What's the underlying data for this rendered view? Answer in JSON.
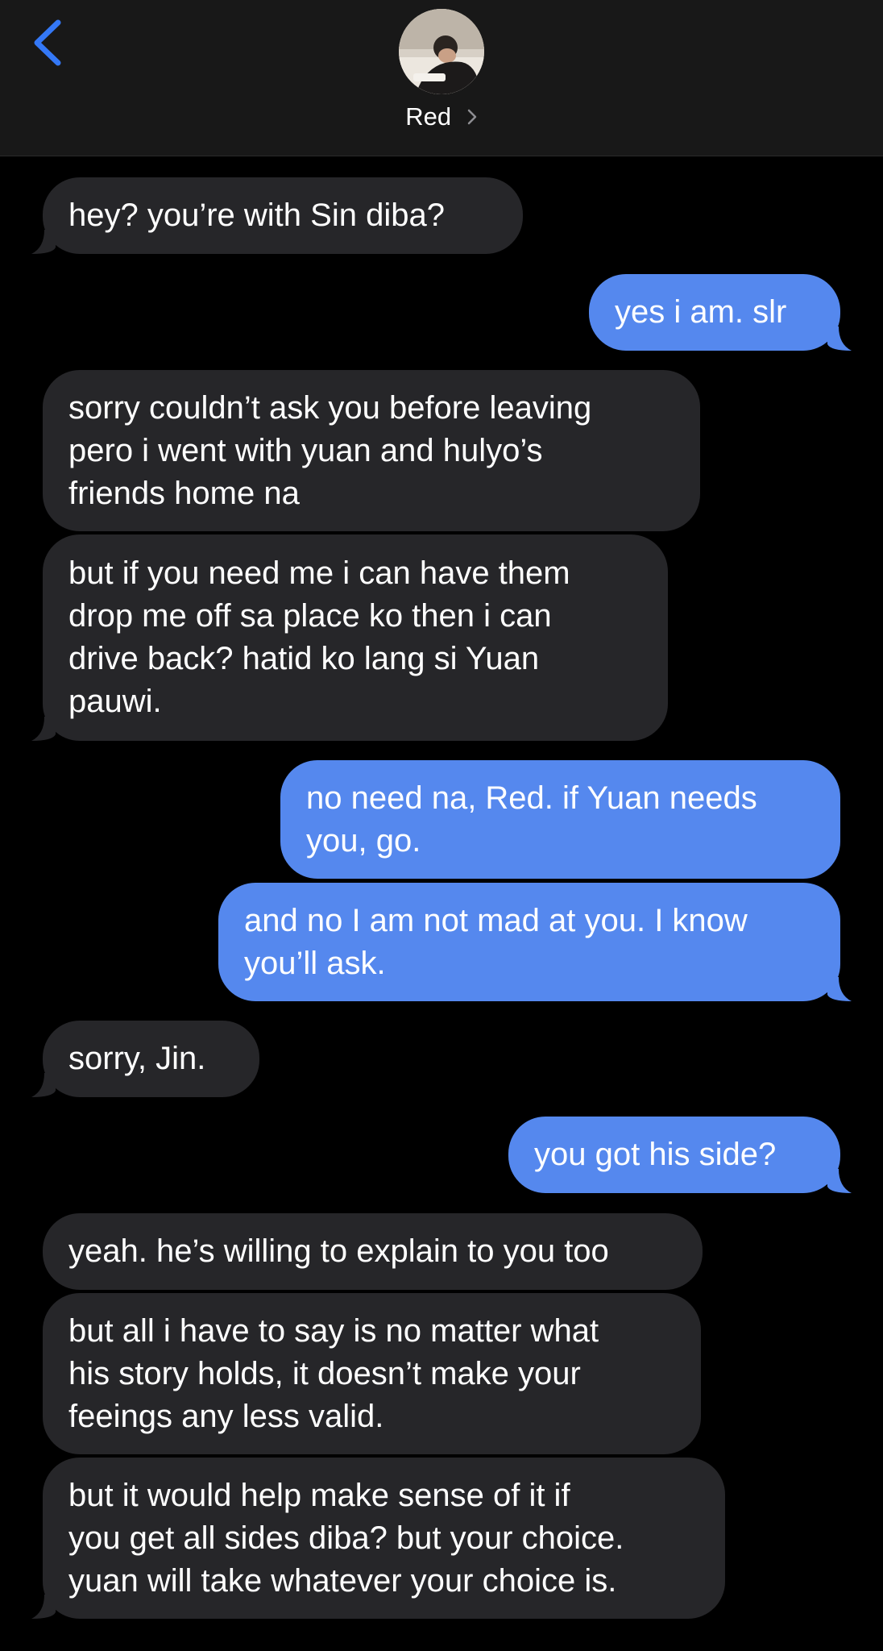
{
  "header": {
    "contact_name": "Red",
    "back_icon": "chevron-left-icon",
    "detail_icon": "chevron-right-icon"
  },
  "colors": {
    "incoming_bubble": "#262629",
    "outgoing_bubble": "#5588ee",
    "accent": "#3478f6",
    "background": "#000000"
  },
  "messages": [
    {
      "from": "them",
      "text": "hey? you’re with Sin diba?"
    },
    {
      "from": "me",
      "text": "yes i am. slr"
    },
    {
      "from": "them",
      "text": "sorry couldn’t ask you before leaving\npero i went with yuan and hulyo’s\nfriends home na"
    },
    {
      "from": "them",
      "text": "but if you need me i can have them\ndrop me off sa place ko then i can\ndrive back? hatid ko lang si Yuan\npauwi."
    },
    {
      "from": "me",
      "text": "no need na, Red. if Yuan needs\nyou, go."
    },
    {
      "from": "me",
      "text": "and no I am not mad at you. I know\nyou’ll ask."
    },
    {
      "from": "them",
      "text": "sorry, Jin."
    },
    {
      "from": "me",
      "text": "you got his side?"
    },
    {
      "from": "them",
      "text": "yeah. he’s willing to explain to you too"
    },
    {
      "from": "them",
      "text": "but all i have to say is no matter what\nhis story holds, it doesn’t make your\nfeeings any less valid."
    },
    {
      "from": "them",
      "text": "but it would help make sense of it if\nyou get all sides diba? but your choice.\nyuan will take whatever your choice is."
    }
  ]
}
